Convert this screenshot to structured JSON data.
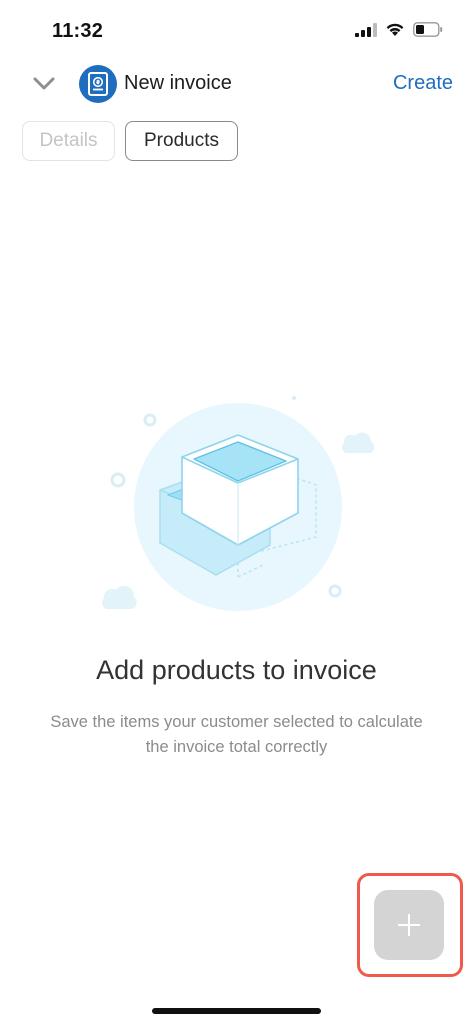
{
  "status_bar": {
    "time": "11:32",
    "signal_icon": "cellular-signal-icon",
    "wifi_icon": "wifi-icon",
    "battery_icon": "battery-icon",
    "battery_level": 0.35
  },
  "header": {
    "back_icon": "chevron-down-icon",
    "avatar_icon": "invoice-document-icon",
    "title": "New invoice",
    "create_label": "Create",
    "accent_color": "#1f6dbf"
  },
  "tabs": [
    {
      "label": "Details",
      "state": "inactive"
    },
    {
      "label": "Products",
      "state": "active"
    }
  ],
  "empty_state": {
    "illustration_icon": "product-boxes-illustration",
    "title": "Add products to invoice",
    "subtitle": "Save the items your customer selected to calculate the invoice total correctly"
  },
  "fab": {
    "icon": "plus-icon",
    "highlight_color": "#ee5a4b"
  }
}
